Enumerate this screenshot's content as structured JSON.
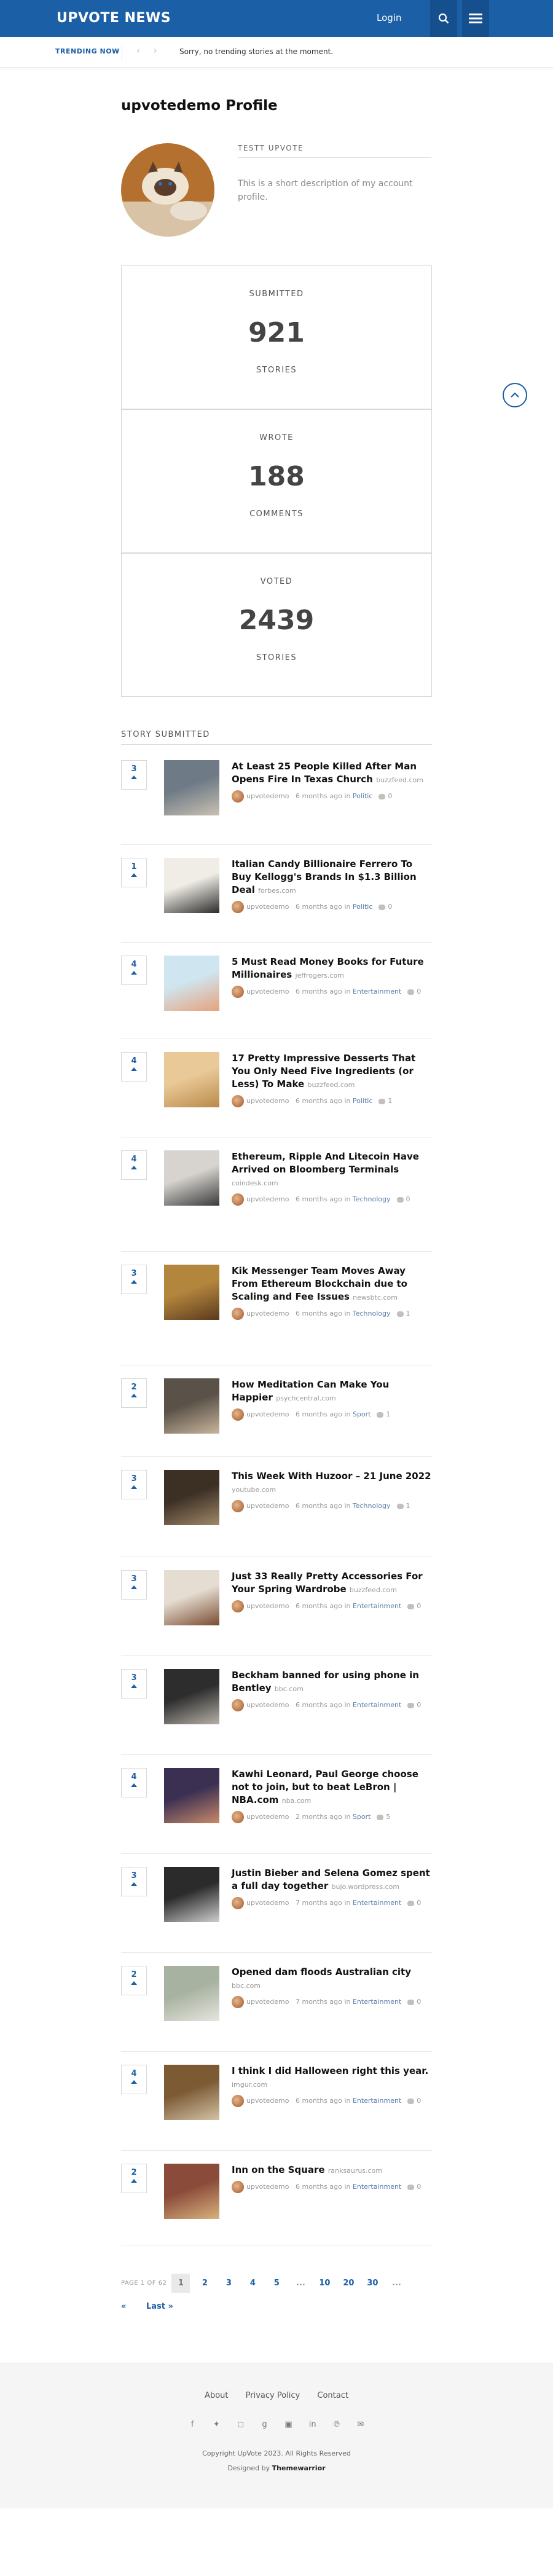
{
  "header": {
    "logo": "UPVOTE NEWS",
    "login": "Login"
  },
  "trending": {
    "label": "TRENDING NOW",
    "text": "Sorry, no trending stories at the moment."
  },
  "profile": {
    "title": "upvotedemo Profile",
    "name": "TESTT UPVOTE",
    "description": "This is a short description of my account profile."
  },
  "stats": [
    {
      "label": "SUBMITTED",
      "value": "921",
      "sub": "STORIES"
    },
    {
      "label": "WROTE",
      "value": "188",
      "sub": "COMMENTS"
    },
    {
      "label": "VOTED",
      "value": "2439",
      "sub": "STORIES"
    }
  ],
  "section_title": "STORY SUBMITTED",
  "stories": [
    {
      "votes": "3",
      "title": "At Least 25 People Killed After Man Opens Fire In Texas Church",
      "domain": "buzzfeed.com",
      "author": "upvotedemo",
      "time": "6 months ago in",
      "category": "Politic",
      "comments": "0"
    },
    {
      "votes": "1",
      "title": "Italian Candy Billionaire Ferrero To Buy Kellogg's Brands In $1.3 Billion Deal",
      "domain": "forbes.com",
      "author": "upvotedemo",
      "time": "6 months ago in",
      "category": "Politic",
      "comments": "0"
    },
    {
      "votes": "4",
      "title": "5 Must Read Money Books for Future Millionaires",
      "domain": "jeffrogers.com",
      "author": "upvotedemo",
      "time": "6 months ago in",
      "category": "Entertainment",
      "comments": "0"
    },
    {
      "votes": "4",
      "title": "17 Pretty Impressive Desserts That You Only Need Five Ingredients (or Less) To Make",
      "domain": "buzzfeed.com",
      "author": "upvotedemo",
      "time": "6 months ago in",
      "category": "Politic",
      "comments": "1"
    },
    {
      "votes": "4",
      "title": "Ethereum, Ripple And Litecoin Have Arrived on Bloomberg Terminals",
      "domain": "coindesk.com",
      "author": "upvotedemo",
      "time": "6 months ago in",
      "category": "Technology",
      "comments": "0"
    },
    {
      "votes": "3",
      "title": "Kik Messenger Team Moves Away From Ethereum Blockchain due to Scaling and Fee Issues",
      "domain": "newsbtc.com",
      "author": "upvotedemo",
      "time": "6 months ago in",
      "category": "Technology",
      "comments": "1"
    },
    {
      "votes": "2",
      "title": "How Meditation Can Make You Happier",
      "domain": "psychcentral.com",
      "author": "upvotedemo",
      "time": "6 months ago in",
      "category": "Sport",
      "comments": "1"
    },
    {
      "votes": "3",
      "title": "This Week With Huzoor – 21 June 2022",
      "domain": "youtube.com",
      "author": "upvotedemo",
      "time": "6 months ago in",
      "category": "Technology",
      "comments": "1"
    },
    {
      "votes": "3",
      "title": "Just 33 Really Pretty Accessories For Your Spring Wardrobe",
      "domain": "buzzfeed.com",
      "author": "upvotedemo",
      "time": "6 months ago in",
      "category": "Entertainment",
      "comments": "0"
    },
    {
      "votes": "3",
      "title": "Beckham banned for using phone in Bentley",
      "domain": "bbc.com",
      "author": "upvotedemo",
      "time": "6 months ago in",
      "category": "Entertainment",
      "comments": "0"
    },
    {
      "votes": "4",
      "title": "Kawhi Leonard, Paul George choose not to join, but to beat LeBron | NBA.com",
      "domain": "nba.com",
      "author": "upvotedemo",
      "time": "2 months ago in",
      "category": "Sport",
      "comments": "5"
    },
    {
      "votes": "3",
      "title": "Justin Bieber and Selena Gomez spent a full day together",
      "domain": "bujo.wordpress.com",
      "author": "upvotedemo",
      "time": "7 months ago in",
      "category": "Entertainment",
      "comments": "0"
    },
    {
      "votes": "2",
      "title": "Opened dam floods Australian city",
      "domain": "bbc.com",
      "author": "upvotedemo",
      "time": "7 months ago in",
      "category": "Entertainment",
      "comments": "0"
    },
    {
      "votes": "4",
      "title": "I think I did Halloween right this year.",
      "domain": "imgur.com",
      "author": "upvotedemo",
      "time": "6 months ago in",
      "category": "Entertainment",
      "comments": "0"
    },
    {
      "votes": "2",
      "title": "Inn on the Square",
      "domain": "ranksaurus.com",
      "author": "upvotedemo",
      "time": "6 months ago in",
      "category": "Entertainment",
      "comments": "0"
    }
  ],
  "pagination": {
    "label": "PAGE 1 OF 62",
    "pages": [
      "1",
      "2",
      "3",
      "4",
      "5",
      "...",
      "10",
      "20",
      "30",
      "..."
    ],
    "prev": "«",
    "last": "Last »"
  },
  "footer": {
    "links": [
      "About",
      "Privacy Policy",
      "Contact"
    ],
    "copyright": "Copyright UpVote 2023. All Rights Reserved",
    "designed_by_prefix": "Designed by",
    "designed_by": "Themewarrior"
  },
  "colors": {
    "brand": "#1b5fa6",
    "brand_dark": "#164f8d"
  }
}
